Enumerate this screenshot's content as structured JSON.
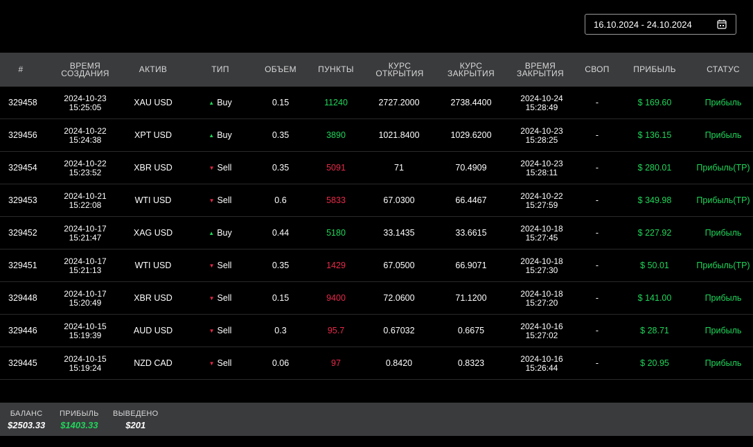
{
  "date_range": "16.10.2024 - 24.10.2024",
  "headers": {
    "num": "#",
    "created_1": "ВРЕМЯ",
    "created_2": "СОЗДАНИЯ",
    "asset": "АКТИВ",
    "type": "ТИП",
    "volume": "ОБЪЕМ",
    "points": "ПУНКТЫ",
    "open_1": "КУРС",
    "open_2": "ОТКРЫТИЯ",
    "close_1": "КУРС",
    "close_2": "ЗАКРЫТИЯ",
    "closetime_1": "ВРЕМЯ",
    "closetime_2": "ЗАКРЫТИЯ",
    "swap": "СВОП",
    "profit": "ПРИБЫЛЬ",
    "status": "СТАТУС"
  },
  "rows": [
    {
      "id": "329458",
      "created_date": "2024-10-23",
      "created_time": "15:25:05",
      "asset": "XAU USD",
      "type": "Buy",
      "direction": "up",
      "volume": "0.15",
      "points": "11240",
      "open": "2727.2000",
      "close": "2738.4400",
      "closed_date": "2024-10-24",
      "closed_time": "15:28:49",
      "swap": "-",
      "profit": "$ 169.60",
      "status": "Прибыль"
    },
    {
      "id": "329456",
      "created_date": "2024-10-22",
      "created_time": "15:24:38",
      "asset": "XPT USD",
      "type": "Buy",
      "direction": "up",
      "volume": "0.35",
      "points": "3890",
      "open": "1021.8400",
      "close": "1029.6200",
      "closed_date": "2024-10-23",
      "closed_time": "15:28:25",
      "swap": "-",
      "profit": "$ 136.15",
      "status": "Прибыль"
    },
    {
      "id": "329454",
      "created_date": "2024-10-22",
      "created_time": "15:23:52",
      "asset": "XBR USD",
      "type": "Sell",
      "direction": "down",
      "volume": "0.35",
      "points": "5091",
      "open": "71",
      "close": "70.4909",
      "closed_date": "2024-10-23",
      "closed_time": "15:28:11",
      "swap": "-",
      "profit": "$ 280.01",
      "status": "Прибыль(TP)"
    },
    {
      "id": "329453",
      "created_date": "2024-10-21",
      "created_time": "15:22:08",
      "asset": "WTI USD",
      "type": "Sell",
      "direction": "down",
      "volume": "0.6",
      "points": "5833",
      "open": "67.0300",
      "close": "66.4467",
      "closed_date": "2024-10-22",
      "closed_time": "15:27:59",
      "swap": "-",
      "profit": "$ 349.98",
      "status": "Прибыль(TP)"
    },
    {
      "id": "329452",
      "created_date": "2024-10-17",
      "created_time": "15:21:47",
      "asset": "XAG USD",
      "type": "Buy",
      "direction": "up",
      "volume": "0.44",
      "points": "5180",
      "open": "33.1435",
      "close": "33.6615",
      "closed_date": "2024-10-18",
      "closed_time": "15:27:45",
      "swap": "-",
      "profit": "$ 227.92",
      "status": "Прибыль"
    },
    {
      "id": "329451",
      "created_date": "2024-10-17",
      "created_time": "15:21:13",
      "asset": "WTI USD",
      "type": "Sell",
      "direction": "down",
      "volume": "0.35",
      "points": "1429",
      "open": "67.0500",
      "close": "66.9071",
      "closed_date": "2024-10-18",
      "closed_time": "15:27:30",
      "swap": "-",
      "profit": "$ 50.01",
      "status": "Прибыль(TP)"
    },
    {
      "id": "329448",
      "created_date": "2024-10-17",
      "created_time": "15:20:49",
      "asset": "XBR USD",
      "type": "Sell",
      "direction": "down",
      "volume": "0.15",
      "points": "9400",
      "open": "72.0600",
      "close": "71.1200",
      "closed_date": "2024-10-18",
      "closed_time": "15:27:20",
      "swap": "-",
      "profit": "$ 141.00",
      "status": "Прибыль"
    },
    {
      "id": "329446",
      "created_date": "2024-10-15",
      "created_time": "15:19:39",
      "asset": "AUD USD",
      "type": "Sell",
      "direction": "down",
      "volume": "0.3",
      "points": "95.7",
      "open": "0.67032",
      "close": "0.6675",
      "closed_date": "2024-10-16",
      "closed_time": "15:27:02",
      "swap": "-",
      "profit": "$ 28.71",
      "status": "Прибыль"
    },
    {
      "id": "329445",
      "created_date": "2024-10-15",
      "created_time": "15:19:24",
      "asset": "NZD CAD",
      "type": "Sell",
      "direction": "down",
      "volume": "0.06",
      "points": "97",
      "open": "0.8420",
      "close": "0.8323",
      "closed_date": "2024-10-16",
      "closed_time": "15:26:44",
      "swap": "-",
      "profit": "$ 20.95",
      "status": "Прибыль"
    }
  ],
  "footer": {
    "balance_label": "БАЛАНС",
    "balance_value": "$2503.33",
    "profit_label": "ПРИБЫЛЬ",
    "profit_value": "$1403.33",
    "withdrawn_label": "ВЫВЕДЕНО",
    "withdrawn_value": "$201"
  },
  "colors": {
    "positive": "#1fd65a",
    "negative": "#e8294a",
    "header_bg": "#3a3b3d"
  },
  "icons": {
    "calendar": "calendar-icon",
    "buy": "triangle-up-icon",
    "sell": "triangle-down-icon"
  }
}
